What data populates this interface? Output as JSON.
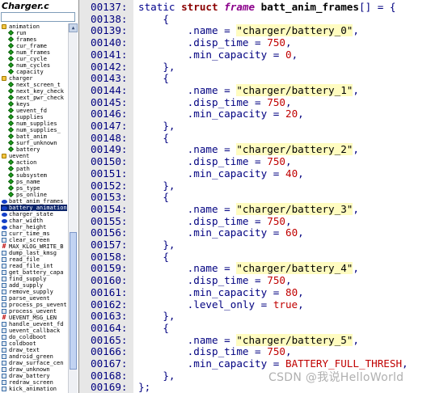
{
  "sidebar": {
    "file_title": "Charger.c",
    "search_value": "",
    "tree": [
      {
        "label": "animation",
        "icon": "folder-icon",
        "indent": 0
      },
      {
        "label": "run",
        "icon": "member-icon",
        "indent": 1
      },
      {
        "label": "frames",
        "icon": "member-icon",
        "indent": 1
      },
      {
        "label": "cur_frame",
        "icon": "member-icon",
        "indent": 1
      },
      {
        "label": "num_frames",
        "icon": "member-icon",
        "indent": 1
      },
      {
        "label": "cur_cycle",
        "icon": "member-icon",
        "indent": 1
      },
      {
        "label": "num_cycles",
        "icon": "member-icon",
        "indent": 1
      },
      {
        "label": "capacity",
        "icon": "member-icon",
        "indent": 1
      },
      {
        "label": "charger",
        "icon": "folder-icon",
        "indent": 0
      },
      {
        "label": "next_screen_t",
        "icon": "member-icon",
        "indent": 1
      },
      {
        "label": "next_key_check",
        "icon": "member-icon",
        "indent": 1
      },
      {
        "label": "next_pwr_check",
        "icon": "member-icon",
        "indent": 1
      },
      {
        "label": "keys",
        "icon": "member-icon",
        "indent": 1
      },
      {
        "label": "uevent_fd",
        "icon": "member-icon",
        "indent": 1
      },
      {
        "label": "supplies",
        "icon": "member-icon",
        "indent": 1
      },
      {
        "label": "num_supplies",
        "icon": "member-icon",
        "indent": 1
      },
      {
        "label": "num_supplies_",
        "icon": "member-icon",
        "indent": 1
      },
      {
        "label": "batt_anim",
        "icon": "member-icon",
        "indent": 1
      },
      {
        "label": "surf_unknown",
        "icon": "member-icon",
        "indent": 1
      },
      {
        "label": "battery",
        "icon": "member-icon",
        "indent": 1
      },
      {
        "label": "uevent",
        "icon": "folder-icon",
        "indent": 0
      },
      {
        "label": "action",
        "icon": "member-icon",
        "indent": 1
      },
      {
        "label": "path",
        "icon": "member-icon",
        "indent": 1
      },
      {
        "label": "subsystem",
        "icon": "member-icon",
        "indent": 1
      },
      {
        "label": "ps_name",
        "icon": "member-icon",
        "indent": 1
      },
      {
        "label": "ps_type",
        "icon": "member-icon",
        "indent": 1
      },
      {
        "label": "ps_online",
        "icon": "member-icon",
        "indent": 1
      },
      {
        "label": "batt_anim_frames",
        "icon": "variable-icon",
        "indent": 0
      },
      {
        "label": "battery_animation",
        "icon": "variable-icon",
        "indent": 0,
        "selected": true
      },
      {
        "label": "charger_state",
        "icon": "variable-icon",
        "indent": 0
      },
      {
        "label": "char_width",
        "icon": "variable-icon",
        "indent": 0
      },
      {
        "label": "char_height",
        "icon": "variable-icon",
        "indent": 0
      },
      {
        "label": "curr_time_ms",
        "icon": "function-icon",
        "indent": 0
      },
      {
        "label": "clear_screen",
        "icon": "function-icon",
        "indent": 0
      },
      {
        "label": "MAX_KLOG_WRITE_B",
        "icon": "macro-icon",
        "indent": 0
      },
      {
        "label": "dump_last_kmsg",
        "icon": "function-icon",
        "indent": 0
      },
      {
        "label": "read_file",
        "icon": "function-icon",
        "indent": 0
      },
      {
        "label": "read_file_int",
        "icon": "function-icon",
        "indent": 0
      },
      {
        "label": "get_battery_capa",
        "icon": "function-icon",
        "indent": 0
      },
      {
        "label": "find_supply",
        "icon": "function-icon",
        "indent": 0
      },
      {
        "label": "add_supply",
        "icon": "function-icon",
        "indent": 0
      },
      {
        "label": "remove_supply",
        "icon": "function-icon",
        "indent": 0
      },
      {
        "label": "parse_uevent",
        "icon": "function-icon",
        "indent": 0
      },
      {
        "label": "process_ps_uevent",
        "icon": "function-icon",
        "indent": 0
      },
      {
        "label": "process_uevent",
        "icon": "function-icon",
        "indent": 0
      },
      {
        "label": "UEVENT_MSG_LEN",
        "icon": "macro-icon",
        "indent": 0
      },
      {
        "label": "handle_uevent_fd",
        "icon": "function-icon",
        "indent": 0
      },
      {
        "label": "uevent_callback",
        "icon": "function-icon",
        "indent": 0
      },
      {
        "label": "do_coldboot",
        "icon": "function-icon",
        "indent": 0
      },
      {
        "label": "coldboot",
        "icon": "function-icon",
        "indent": 0
      },
      {
        "label": "draw_text",
        "icon": "function-icon",
        "indent": 0
      },
      {
        "label": "android_green",
        "icon": "function-icon",
        "indent": 0
      },
      {
        "label": "draw_surface_cen",
        "icon": "function-icon",
        "indent": 0
      },
      {
        "label": "draw_unknown",
        "icon": "function-icon",
        "indent": 0
      },
      {
        "label": "draw_battery",
        "icon": "function-icon",
        "indent": 0
      },
      {
        "label": "redraw_screen",
        "icon": "function-icon",
        "indent": 0
      },
      {
        "label": "kick_animation",
        "icon": "function-icon",
        "indent": 0
      }
    ]
  },
  "code": {
    "lines": [
      {
        "n": "00137:",
        "tokens": [
          [
            "static ",
            "kw-static"
          ],
          [
            "struct ",
            "kw-struct"
          ],
          [
            "frame ",
            "kw-frame"
          ],
          [
            "batt_anim_frames",
            "ident"
          ],
          [
            "[] = {",
            "punc"
          ]
        ]
      },
      {
        "n": "00138:",
        "tokens": [
          [
            "    {",
            "punc"
          ]
        ]
      },
      {
        "n": "00139:",
        "tokens": [
          [
            "        .name = ",
            "punc"
          ],
          [
            "\"charger/battery_0\"",
            "str"
          ],
          [
            ",",
            "punc"
          ]
        ]
      },
      {
        "n": "00140:",
        "tokens": [
          [
            "        .disp_time = ",
            "punc"
          ],
          [
            "750",
            "num"
          ],
          [
            ",",
            "punc"
          ]
        ]
      },
      {
        "n": "00141:",
        "tokens": [
          [
            "        .min_capacity = ",
            "punc"
          ],
          [
            "0",
            "num"
          ],
          [
            ",",
            "punc"
          ]
        ]
      },
      {
        "n": "00142:",
        "tokens": [
          [
            "    },",
            "punc"
          ]
        ]
      },
      {
        "n": "00143:",
        "tokens": [
          [
            "    {",
            "punc"
          ]
        ]
      },
      {
        "n": "00144:",
        "tokens": [
          [
            "        .name = ",
            "punc"
          ],
          [
            "\"charger/battery_1\"",
            "str"
          ],
          [
            ",",
            "punc"
          ]
        ]
      },
      {
        "n": "00145:",
        "tokens": [
          [
            "        .disp_time = ",
            "punc"
          ],
          [
            "750",
            "num"
          ],
          [
            ",",
            "punc"
          ]
        ]
      },
      {
        "n": "00146:",
        "tokens": [
          [
            "        .min_capacity = ",
            "punc"
          ],
          [
            "20",
            "num"
          ],
          [
            ",",
            "punc"
          ]
        ]
      },
      {
        "n": "00147:",
        "tokens": [
          [
            "    },",
            "punc"
          ]
        ]
      },
      {
        "n": "00148:",
        "tokens": [
          [
            "    {",
            "punc"
          ]
        ]
      },
      {
        "n": "00149:",
        "tokens": [
          [
            "        .name = ",
            "punc"
          ],
          [
            "\"charger/battery_2\"",
            "str"
          ],
          [
            ",",
            "punc"
          ]
        ]
      },
      {
        "n": "00150:",
        "tokens": [
          [
            "        .disp_time = ",
            "punc"
          ],
          [
            "750",
            "num"
          ],
          [
            ",",
            "punc"
          ]
        ]
      },
      {
        "n": "00151:",
        "tokens": [
          [
            "        .min_capacity = ",
            "punc"
          ],
          [
            "40",
            "num"
          ],
          [
            ",",
            "punc"
          ]
        ]
      },
      {
        "n": "00152:",
        "tokens": [
          [
            "    },",
            "punc"
          ]
        ]
      },
      {
        "n": "00153:",
        "tokens": [
          [
            "    {",
            "punc"
          ]
        ]
      },
      {
        "n": "00154:",
        "tokens": [
          [
            "        .name = ",
            "punc"
          ],
          [
            "\"charger/battery_3\"",
            "str"
          ],
          [
            ",",
            "punc"
          ]
        ]
      },
      {
        "n": "00155:",
        "tokens": [
          [
            "        .disp_time = ",
            "punc"
          ],
          [
            "750",
            "num"
          ],
          [
            ",",
            "punc"
          ]
        ]
      },
      {
        "n": "00156:",
        "tokens": [
          [
            "        .min_capacity = ",
            "punc"
          ],
          [
            "60",
            "num"
          ],
          [
            ",",
            "punc"
          ]
        ]
      },
      {
        "n": "00157:",
        "tokens": [
          [
            "    },",
            "punc"
          ]
        ]
      },
      {
        "n": "00158:",
        "tokens": [
          [
            "    {",
            "punc"
          ]
        ]
      },
      {
        "n": "00159:",
        "tokens": [
          [
            "        .name = ",
            "punc"
          ],
          [
            "\"charger/battery_4\"",
            "str"
          ],
          [
            ",",
            "punc"
          ]
        ]
      },
      {
        "n": "00160:",
        "tokens": [
          [
            "        .disp_time = ",
            "punc"
          ],
          [
            "750",
            "num"
          ],
          [
            ",",
            "punc"
          ]
        ]
      },
      {
        "n": "00161:",
        "tokens": [
          [
            "        .min_capacity = ",
            "punc"
          ],
          [
            "80",
            "num"
          ],
          [
            ",",
            "punc"
          ]
        ]
      },
      {
        "n": "00162:",
        "tokens": [
          [
            "        .level_only = ",
            "punc"
          ],
          [
            "true",
            "num"
          ],
          [
            ",",
            "punc"
          ]
        ]
      },
      {
        "n": "00163:",
        "tokens": [
          [
            "    },",
            "punc"
          ]
        ]
      },
      {
        "n": "00164:",
        "tokens": [
          [
            "    {",
            "punc"
          ]
        ]
      },
      {
        "n": "00165:",
        "tokens": [
          [
            "        .name = ",
            "punc"
          ],
          [
            "\"charger/battery_5\"",
            "str"
          ],
          [
            ",",
            "punc"
          ]
        ]
      },
      {
        "n": "00166:",
        "tokens": [
          [
            "        .disp_time = ",
            "punc"
          ],
          [
            "750",
            "num"
          ],
          [
            ",",
            "punc"
          ]
        ]
      },
      {
        "n": "00167:",
        "tokens": [
          [
            "        .min_capacity = ",
            "punc"
          ],
          [
            "BATTERY_FULL_THRESH",
            "const"
          ],
          [
            ",",
            "punc"
          ]
        ]
      },
      {
        "n": "00168:",
        "tokens": [
          [
            "    },",
            "punc"
          ]
        ]
      },
      {
        "n": "00169:",
        "tokens": [
          [
            "};",
            "punc"
          ]
        ]
      }
    ]
  },
  "watermark": "CSDN @我说HelloWorld",
  "colors": {
    "gutter_bg": "#e7e7e7",
    "line_number": "#000080",
    "string_highlight": "#fffcc0",
    "number": "#c00000",
    "selection": "#0a246a"
  }
}
